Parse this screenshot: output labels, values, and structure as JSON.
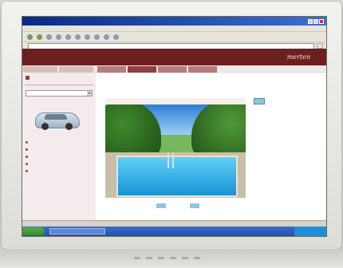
{
  "browser": {
    "title": "",
    "menu": [],
    "toolbar_labels": [],
    "address_label": "",
    "address_value": "",
    "go_label": "",
    "status_text": ""
  },
  "site": {
    "brand": "merten",
    "top_nav": [],
    "left_tabs": [],
    "main_tabs": [],
    "active_main_tab_index": 1
  },
  "sidebar": {
    "info_lines": [],
    "select_header": "",
    "select_value": "",
    "features_header": "",
    "features": []
  },
  "content": {
    "breadcrumb": "",
    "page_title": "",
    "photo_caption": "",
    "photo_buttons": []
  },
  "taskbar": {
    "start_label": "",
    "task_label": "",
    "tray_text": ""
  },
  "colors": {
    "banner": "#6b1f1f",
    "tab": "#b77c7c",
    "title_red": "#a0302c",
    "taskbar_blue": "#2451a8"
  }
}
